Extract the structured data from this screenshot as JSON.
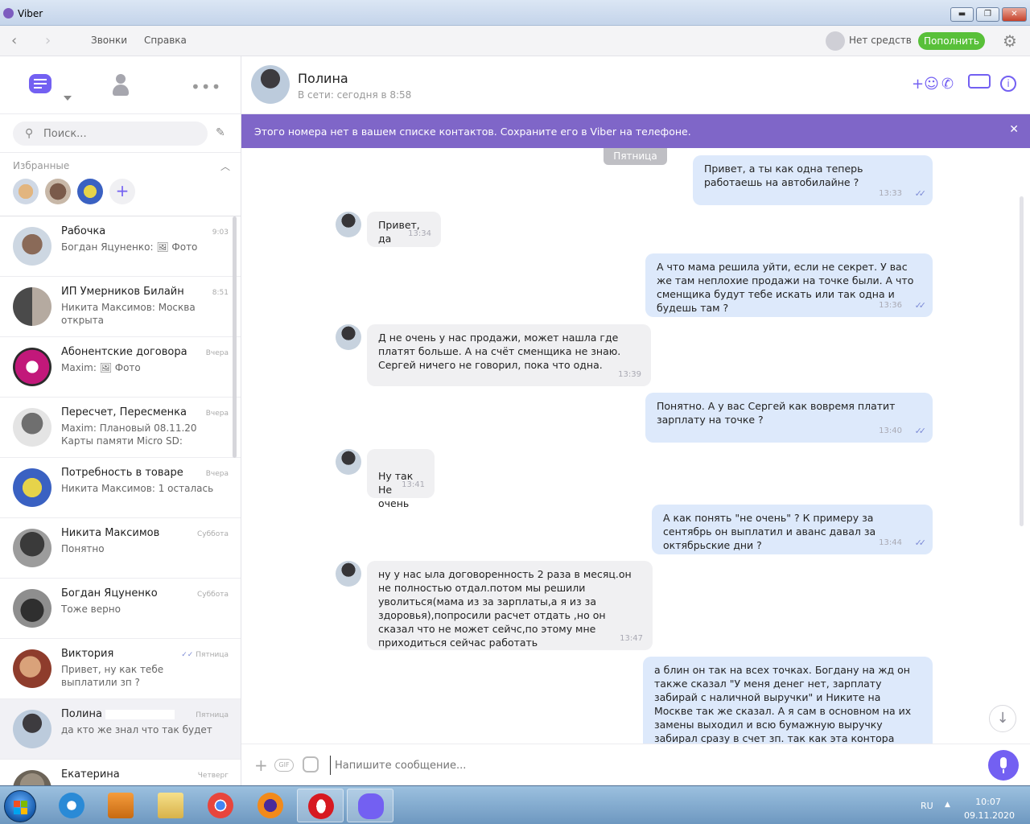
{
  "window": {
    "title": "Viber",
    "minimize": "▬",
    "maximize": "❐",
    "close": "✕"
  },
  "toolbar": {
    "back": "‹",
    "forward": "›",
    "menu": [
      "Звонки",
      "Справка"
    ],
    "balance": "Нет средств",
    "topup": "Пополнить"
  },
  "sidebar": {
    "more": "•••",
    "search_placeholder": "Поиск...",
    "favorites_label": "Избранные",
    "favorites_add": "+",
    "chats": [
      {
        "name": "Рабочка",
        "time": "9:03",
        "sender": "Богдан Яцуненко:",
        "text": "🖼 Фото"
      },
      {
        "name": "ИП Умерников Билайн",
        "time": "8:51",
        "sender": "Никита Максимов:",
        "text": "Москва открыта"
      },
      {
        "name": "Абонентские договора",
        "time": "Вчера",
        "sender": "Maxim:",
        "text": "🖼 Фото"
      },
      {
        "name": "Пересчет, Пересменка",
        "time": "Вчера",
        "sender": "Maxim:",
        "text": "Плановый 08.11.20 Карты памяти Micro SD:"
      },
      {
        "name": "Потребность в товаре",
        "time": "Вчера",
        "sender": "Никита Максимов:",
        "text": "1 осталась"
      },
      {
        "name": "Никита Максимов",
        "time": "Суббота",
        "sender": "",
        "text": "Понятно"
      },
      {
        "name": "Богдан Яцуненко",
        "time": "Суббота",
        "sender": "",
        "text": "Тоже верно"
      },
      {
        "name": "Виктория",
        "time": "Пятница",
        "sender": "",
        "text": "Привет, ну как тебе выплатили зп ?"
      },
      {
        "name": "Полина",
        "time": "Пятница",
        "sender": "",
        "text": "да кто же знал что так будет"
      },
      {
        "name": "Екатерина",
        "time": "Четверг",
        "sender": "",
        "text": ""
      }
    ]
  },
  "conversation": {
    "name": "Полина",
    "status": "В сети: сегодня в 8:58",
    "banner": "Этого номера нет в вашем списке контактов. Сохраните его в Viber на телефоне.",
    "banner_close": "✕",
    "date_separator": "Пятница",
    "messages": [
      {
        "dir": "out",
        "text": "Привет, а ты как одна теперь работаешь на автобилайне ?",
        "time": "13:33"
      },
      {
        "dir": "in",
        "text": "Привет, да",
        "time": "13:34"
      },
      {
        "dir": "out",
        "text": "А что мама решила уйти, если не секрет. У вас же там неплохие продажи на точке были. А что сменщика будут тебе искать или так одна и будешь там ?",
        "time": "13:36"
      },
      {
        "dir": "in",
        "text": "Д не очень у нас продажи, может нашла где платят больше. А на счёт сменщика не знаю. Сергей ничего не говорил, пока что одна.",
        "time": "13:39"
      },
      {
        "dir": "out",
        "text": "Понятно. А у вас Сергей как вовремя платит зарплату на точке ?",
        "time": "13:40"
      },
      {
        "dir": "in",
        "text": "Ну так\nНе очень",
        "time": "13:41"
      },
      {
        "dir": "out",
        "text": "А как понять \"не очень\" ? К примеру за сентябрь он выплатил и аванс давал за октябрьские дни ?",
        "time": "13:44"
      },
      {
        "dir": "in",
        "text": "ну у нас ыла договоренность 2 раза в месяц.он не полностью отдал.потом мы решили уволиться(мама из за зарплаты,а я из за здоровья),попросили расчет отдать ,но он сказал что не может сейчс,по этому мне приходиться сейчас работать",
        "time": "13:47"
      },
      {
        "dir": "out",
        "text": "а блин он так на всех точках. Богдану на жд он также сказал \"У меня денег нет, зарплату  забирай с наличной выручки\" и Никите на Москве так же сказал. А я сам в основном на их замены выходил и всю бумажную выручку забирал сразу в счет зп. так как эта контора сразу показалась мне сомнительной и",
        "time": ""
      }
    ],
    "ticks": "✓✓",
    "jump_down": "↓"
  },
  "composer": {
    "plus": "+",
    "gif": "GIF",
    "placeholder": "Напишите сообщение..."
  },
  "taskbar": {
    "lang": "RU",
    "tray_arrow": "▲",
    "time": "10:07",
    "date": "09.11.2020"
  },
  "colors": {
    "viber_purple": "#7360f2",
    "banner": "#7f66c8",
    "outgoing": "#dde9fb",
    "incoming": "#f0f0f2",
    "topup_green": "#58c039"
  }
}
